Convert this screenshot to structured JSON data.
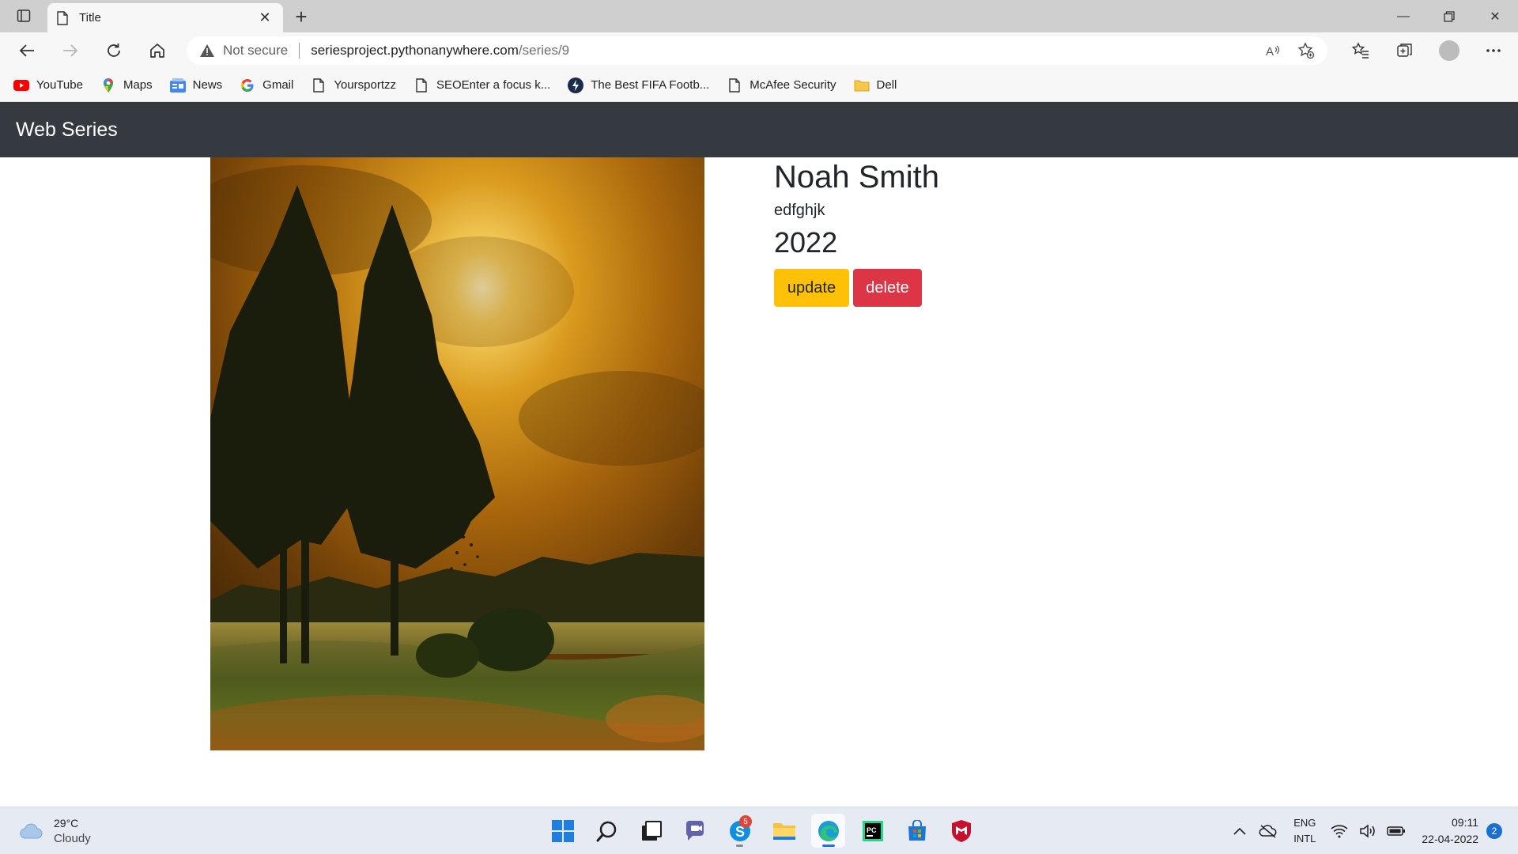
{
  "browser": {
    "tab_title": "Title",
    "address": {
      "security_label": "Not secure",
      "url_host": "seriesproject.pythonanywhere.com",
      "url_path": "/series/9"
    },
    "bookmarks": [
      {
        "label": "YouTube",
        "icon": "youtube-icon"
      },
      {
        "label": "Maps",
        "icon": "maps-icon"
      },
      {
        "label": "News",
        "icon": "news-icon"
      },
      {
        "label": "Gmail",
        "icon": "google-icon"
      },
      {
        "label": "Yoursportzz",
        "icon": "page-icon"
      },
      {
        "label": "SEOEnter a focus k...",
        "icon": "page-icon"
      },
      {
        "label": "The Best FIFA Footb...",
        "icon": "bolt-icon"
      },
      {
        "label": "McAfee Security",
        "icon": "page-icon"
      },
      {
        "label": "Dell",
        "icon": "folder-icon"
      }
    ]
  },
  "page": {
    "brand": "Web Series",
    "series": {
      "title": "Noah Smith",
      "description": "edfghjk",
      "year": "2022"
    },
    "buttons": {
      "update_label": "update",
      "delete_label": "delete"
    },
    "colors": {
      "navbar": "#343a40",
      "update": "#ffc107",
      "delete": "#dc3545"
    }
  },
  "taskbar": {
    "weather_temp": "29°C",
    "weather_condition": "Cloudy",
    "skype_badge": "5",
    "language_1": "ENG",
    "language_2": "INTL",
    "time": "09:11",
    "date": "22-04-2022",
    "notification_count": "2"
  }
}
